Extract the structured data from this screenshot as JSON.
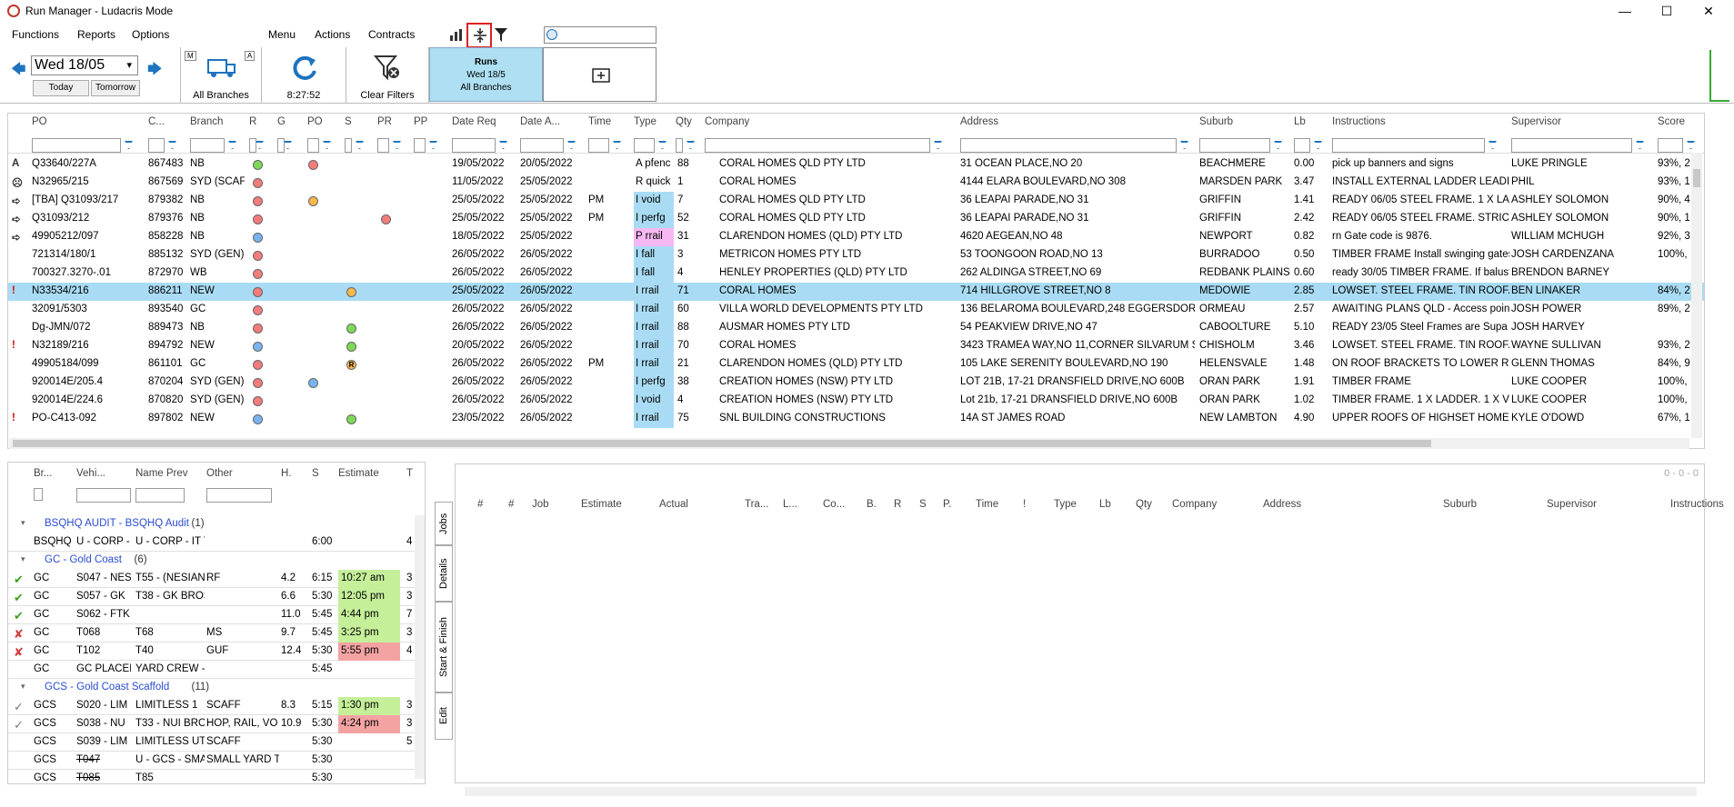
{
  "app": {
    "title": "Run Manager - Ludacris Mode"
  },
  "menu": [
    "Functions",
    "Reports",
    "Options"
  ],
  "menu2": [
    "Menu",
    "Actions",
    "Contracts"
  ],
  "toolbar": {
    "date": "Wed 18/05",
    "today": "Today",
    "tomorrow": "Tomorrow",
    "m": "M",
    "a": "A",
    "branches": "All Branches",
    "time": "8:27:52",
    "clear": "Clear Filters",
    "runs_title": "Runs",
    "runs_date": "Wed 18/5",
    "runs_branch": "All Branches"
  },
  "grid": {
    "headers": [
      "PO",
      "C...",
      "Branch",
      "R",
      "G",
      "PO",
      "S",
      "PR",
      "PP",
      "Date Req",
      "Date A...",
      "Time",
      "Type",
      "Qty",
      "Company",
      "Address",
      "Suburb",
      "Lb",
      "Instructions",
      "Supervisor",
      "Score"
    ],
    "rows": [
      {
        "icon": "A",
        "po": "Q33640/227A",
        "c": "867483",
        "branch": "NB",
        "r": "",
        "g": "green",
        "p": "red",
        "s": "",
        "pr": "",
        "dreq": "19/05/2022",
        "da": "20/05/2022",
        "time": "",
        "type": "A pfenc",
        "qty": "88",
        "company": "CORAL HOMES QLD PTY LTD",
        "address": "31 OCEAN PLACE,NO 20",
        "suburb": "BEACHMERE",
        "lb": "0.00",
        "instr": "pick up banners and signs",
        "sup": "LUKE PRINGLE",
        "score": "93%, 2"
      },
      {
        "icon": "☹",
        "po": "N32965/215",
        "c": "867569",
        "branch": "SYD (SCAFF",
        "r": "",
        "g": "red",
        "p": "",
        "s": "",
        "pr": "",
        "dreq": "11/05/2022",
        "da": "25/05/2022",
        "time": "",
        "type": "R quick",
        "qty": "1",
        "company": "CORAL HOMES",
        "address": "4144 ELARA BOULEVARD,NO 308",
        "suburb": "MARSDEN PARK",
        "lb": "3.47",
        "instr": "INSTALL EXTERNAL LADDER LEADING",
        "sup": "PHIL",
        "score": "93%, 1"
      },
      {
        "icon": "➪",
        "po": "[TBA] Q31093/217",
        "c": "879382",
        "branch": "NB",
        "r": "",
        "g": "red",
        "p": "orange",
        "s": "",
        "pr": "",
        "dreq": "25/05/2022",
        "da": "25/05/2022",
        "time": "PM",
        "type": "I void",
        "qty": "7",
        "company": "CORAL HOMES QLD PTY LTD",
        "address": "36 LEAPAI PARADE,NO 31",
        "suburb": "GRIFFIN",
        "lb": "1.41",
        "instr": "READY 06/05 STEEL FRAME. 1 X LADI",
        "sup": "ASHLEY SOLOMON",
        "score": "90%, 4"
      },
      {
        "icon": "➪",
        "po": "Q31093/212",
        "c": "879376",
        "branch": "NB",
        "r": "",
        "g": "red",
        "p": "",
        "s": "",
        "pr": "red",
        "dreq": "25/05/2022",
        "da": "25/05/2022",
        "time": "PM",
        "type": "I perfg",
        "qty": "52",
        "company": "CORAL HOMES QLD PTY LTD",
        "address": "36 LEAPAI PARADE,NO 31",
        "suburb": "GRIFFIN",
        "lb": "2.42",
        "instr": "READY 06/05 STEEL FRAME. STRICTLY",
        "sup": "ASHLEY SOLOMON",
        "score": "90%, 1"
      },
      {
        "icon": "➪",
        "po": "49905212/097",
        "c": "858228",
        "branch": "NB",
        "r": "",
        "g": "blue",
        "p": "",
        "s": "",
        "pr": "",
        "dreq": "18/05/2022",
        "da": "25/05/2022",
        "time": "",
        "type": "P rrail",
        "qty": "31",
        "company": "CLARENDON HOMES (QLD) PTY LTD",
        "address": "4620 AEGEAN,NO 48",
        "suburb": "NEWPORT",
        "lb": "0.82",
        "instr": "rn Gate code is 9876.",
        "sup": "WILLIAM MCHUGH",
        "score": "92%, 3"
      },
      {
        "icon": "",
        "po": "721314/180/1",
        "c": "885132",
        "branch": "SYD (GEN)",
        "r": "",
        "g": "red",
        "p": "",
        "s": "",
        "pr": "",
        "dreq": "26/05/2022",
        "da": "26/05/2022",
        "time": "",
        "type": "I fall",
        "qty": "3",
        "company": "METRICON HOMES PTY LTD",
        "address": "53 TOONGOON ROAD,NO 13",
        "suburb": "BURRADOO",
        "lb": "0.50",
        "instr": "TIMBER FRAME Install swinging gates",
        "sup": "JOSH CARDENZANA",
        "score": "100%,"
      },
      {
        "icon": "",
        "po": "700327.3270-.01",
        "c": "872970",
        "branch": "WB",
        "r": "",
        "g": "red",
        "p": "",
        "s": "",
        "pr": "",
        "dreq": "26/05/2022",
        "da": "26/05/2022",
        "time": "",
        "type": "I fall",
        "qty": "4",
        "company": "HENLEY PROPERTIES (QLD) PTY LTD",
        "address": "262 ALDINGA STREET,NO 69",
        "suburb": "REDBANK PLAINS",
        "lb": "0.60",
        "instr": "ready 30/05 TIMBER FRAME. If balust",
        "sup": "BRENDON BARNEY",
        "score": ""
      },
      {
        "icon": "!",
        "po": "N33534/216",
        "c": "886211",
        "branch": "NEW",
        "r": "",
        "g": "red",
        "p": "",
        "s": "orange",
        "pr": "",
        "dreq": "25/05/2022",
        "da": "26/05/2022",
        "time": "",
        "type": "I rrail",
        "qty": "71",
        "company": "CORAL HOMES",
        "address": "714 HILLGROVE STREET,NO 8",
        "suburb": "MEDOWIE",
        "lb": "2.85",
        "instr": "LOWSET. STEEL FRAME. TIN ROOF. H",
        "sup": "BEN LINAKER",
        "score": "84%, 2",
        "sel": true
      },
      {
        "icon": "",
        "po": "32091/5303",
        "c": "893540",
        "branch": "GC",
        "r": "",
        "g": "red",
        "p": "",
        "s": "",
        "pr": "",
        "dreq": "26/05/2022",
        "da": "26/05/2022",
        "time": "",
        "type": "I rrail",
        "qty": "60",
        "company": "VILLA WORLD DEVELOPMENTS PTY LTD",
        "address": "136 BELAROMA BOULEVARD,248 EGGERSDORF F",
        "suburb": "ORMEAU",
        "lb": "2.57",
        "instr": "AWAITING PLANS QLD - Access poin",
        "sup": "JOSH POWER",
        "score": "89%, 2"
      },
      {
        "icon": "",
        "po": "Dg-JMN/072",
        "c": "889473",
        "branch": "NB",
        "r": "",
        "g": "red",
        "p": "",
        "s": "green",
        "pr": "",
        "dreq": "26/05/2022",
        "da": "26/05/2022",
        "time": "",
        "type": "I rrail",
        "qty": "88",
        "company": "AUSMAR HOMES PTY LTD",
        "address": "54 PEAKVIEW DRIVE,NO 47",
        "suburb": "CABOOLTURE",
        "lb": "5.10",
        "instr": "READY 23/05 Steel Frames are Supa L",
        "sup": "JOSH HARVEY",
        "score": ""
      },
      {
        "icon": "!",
        "po": "N32189/216",
        "c": "894792",
        "branch": "NEW",
        "r": "",
        "g": "blue",
        "p": "",
        "s": "green",
        "pr": "",
        "dreq": "20/05/2022",
        "da": "26/05/2022",
        "time": "",
        "type": "I rrail",
        "qty": "70",
        "company": "CORAL HOMES",
        "address": "3423 TRAMEA WAY,NO 11,CORNER SILVARUM ST",
        "suburb": "CHISHOLM",
        "lb": "3.46",
        "instr": "LOWSET. STEEL FRAME. TIN ROOF. H",
        "sup": "WAYNE SULLIVAN",
        "score": "93%, 2"
      },
      {
        "icon": "",
        "po": "49905184/099",
        "c": "861101",
        "branch": "GC",
        "r": "",
        "g": "red",
        "p": "",
        "s": "R",
        "pr": "",
        "dreq": "26/05/2022",
        "da": "26/05/2022",
        "time": "PM",
        "type": "I rrail",
        "qty": "21",
        "company": "CLARENDON HOMES (QLD) PTY LTD",
        "address": "105 LAKE SERENITY BOULEVARD,NO 190",
        "suburb": "HELENSVALE",
        "lb": "1.48",
        "instr": "ON ROOF BRACKETS TO LOWER ROC",
        "sup": "GLENN THOMAS",
        "score": "84%, 9"
      },
      {
        "icon": "",
        "po": "920014E/205.4",
        "c": "870204",
        "branch": "SYD (GEN)",
        "r": "",
        "g": "red",
        "p": "blue",
        "s": "",
        "pr": "",
        "dreq": "26/05/2022",
        "da": "26/05/2022",
        "time": "",
        "type": "I perfg",
        "qty": "38",
        "company": "CREATION HOMES (NSW) PTY LTD",
        "address": "LOT 21B, 17-21 DRANSFIELD DRIVE,NO 600B",
        "suburb": "ORAN PARK",
        "lb": "1.91",
        "instr": "TIMBER FRAME",
        "sup": "LUKE COOPER",
        "score": "100%,"
      },
      {
        "icon": "",
        "po": "920014E/224.6",
        "c": "870820",
        "branch": "SYD (GEN)",
        "r": "",
        "g": "red",
        "p": "",
        "s": "",
        "pr": "",
        "dreq": "26/05/2022",
        "da": "26/05/2022",
        "time": "",
        "type": "I void",
        "qty": "4",
        "company": "CREATION HOMES (NSW) PTY LTD",
        "address": "Lot 21b, 17-21 DRANSFIELD DRIVE,NO 600B",
        "suburb": "ORAN PARK",
        "lb": "1.02",
        "instr": "TIMBER FRAME. 1 X LADDER. 1 X VOI",
        "sup": "LUKE COOPER",
        "score": "100%,"
      },
      {
        "icon": "!",
        "po": "PO-C413-092",
        "c": "897802",
        "branch": "NEW",
        "r": "",
        "g": "blue",
        "p": "",
        "s": "green",
        "pr": "",
        "dreq": "23/05/2022",
        "da": "26/05/2022",
        "time": "",
        "type": "I rrail",
        "qty": "75",
        "company": "SNL BUILDING CONSTRUCTIONS",
        "address": "14A ST JAMES ROAD",
        "suburb": "NEW LAMBTON",
        "lb": "4.90",
        "instr": "UPPER ROOFS OF HIGHSET HOME FC",
        "sup": "KYLE O'DOWD",
        "score": "67%, 1"
      }
    ]
  },
  "lower": {
    "headers": [
      "Br...",
      "Vehi...",
      "Name Prev",
      "Other",
      "H.",
      "S",
      "Estimate",
      "T"
    ],
    "groups": [
      {
        "label": "BSQHQ AUDIT - BSQHQ Audit",
        "count": "(1)",
        "rows": [
          {
            "check": "",
            "br": "BSQHQ",
            "veh": "U - CORP -",
            "name": "U - CORP - IT TI",
            "other": "",
            "h": "",
            "s": "6:00",
            "est": "",
            "estc": "",
            "t": "4"
          }
        ]
      },
      {
        "label": "GC - Gold Coast",
        "count": "(6)",
        "rows": [
          {
            "check": "✔",
            "br": "GC",
            "veh": "S047 - NES",
            "name": "T55 - (NESIAN S",
            "other": "RF",
            "h": "4.2",
            "s": "6:15",
            "est": "10:27 am",
            "estc": "#c6ef9a",
            "t": "3"
          },
          {
            "check": "✔",
            "br": "GC",
            "veh": "S057 - GK",
            "name": "T38 - GK BROS",
            "other": "",
            "h": "6.6",
            "s": "5:30",
            "est": "12:05 pm",
            "estc": "#c6ef9a",
            "t": "3"
          },
          {
            "check": "✔",
            "br": "GC",
            "veh": "S062 - FTK",
            "name": "",
            "other": "",
            "h": "11.0",
            "s": "5:45",
            "est": "4:44 pm",
            "estc": "#c6ef9a",
            "t": "7"
          },
          {
            "check": "✘",
            "br": "GC",
            "veh": "T068",
            "name": "T68",
            "other": "MS",
            "h": "9.7",
            "s": "5:45",
            "est": "3:25 pm",
            "estc": "#c6ef9a",
            "t": "3"
          },
          {
            "check": "✘",
            "br": "GC",
            "veh": "T102",
            "name": "T40",
            "other": "GUF",
            "h": "12.4",
            "s": "5:30",
            "est": "5:55 pm",
            "estc": "#f4a3a3",
            "t": "4"
          },
          {
            "check": "",
            "br": "GC",
            "veh": "GC PLACEI",
            "name": "YARD CREW - G",
            "other": "",
            "h": "",
            "s": "5:45",
            "est": "",
            "estc": "",
            "t": ""
          }
        ]
      },
      {
        "label": "GCS - Gold Coast Scaffold",
        "count": "(11)",
        "rows": [
          {
            "check": "✓",
            "br": "GCS",
            "veh": "S020 - LIM",
            "name": "LIMITLESS 1",
            "other": "SCAFF",
            "h": "8.3",
            "s": "5:15",
            "est": "1:30 pm",
            "estc": "#c6ef9a",
            "t": "3"
          },
          {
            "check": "✓",
            "br": "GCS",
            "veh": "S038 - NU",
            "name": "T33 - NUI BROS",
            "other": "HOP, RAIL, VO",
            "h": "10.9",
            "s": "5:30",
            "est": "4:24 pm",
            "estc": "#f4a3a3",
            "t": "3"
          },
          {
            "check": "",
            "br": "GCS",
            "veh": "S039 - LIM",
            "name": "LIMITLESS UTE",
            "other": "SCAFF",
            "h": "",
            "s": "5:30",
            "est": "",
            "estc": "",
            "t": "5"
          },
          {
            "check": "",
            "br": "GCS",
            "veh": "T047",
            "name": "U - GCS - SMAL",
            "other": "SMALL YARD T",
            "h": "",
            "s": "5:30",
            "est": "",
            "estc": "",
            "t": ""
          },
          {
            "check": "",
            "br": "GCS",
            "veh": "T085",
            "name": "T85",
            "other": "",
            "h": "",
            "s": "5:30",
            "est": "",
            "estc": "",
            "t": ""
          }
        ]
      }
    ]
  },
  "tabs": [
    "Jobs",
    "Details",
    "Start & Finish",
    "Edit"
  ],
  "right": {
    "counter": "0 - 0 - 0",
    "headers": [
      "#",
      "#",
      "Job",
      "Estimate",
      "Actual",
      "Tra...",
      "L...",
      "Co...",
      "B.",
      "R",
      "S",
      "P.",
      "Time",
      "!",
      "Type",
      "Lb",
      "Qty",
      "Company",
      "Address",
      "Suburb",
      "Supervisor",
      "Instructions"
    ]
  }
}
